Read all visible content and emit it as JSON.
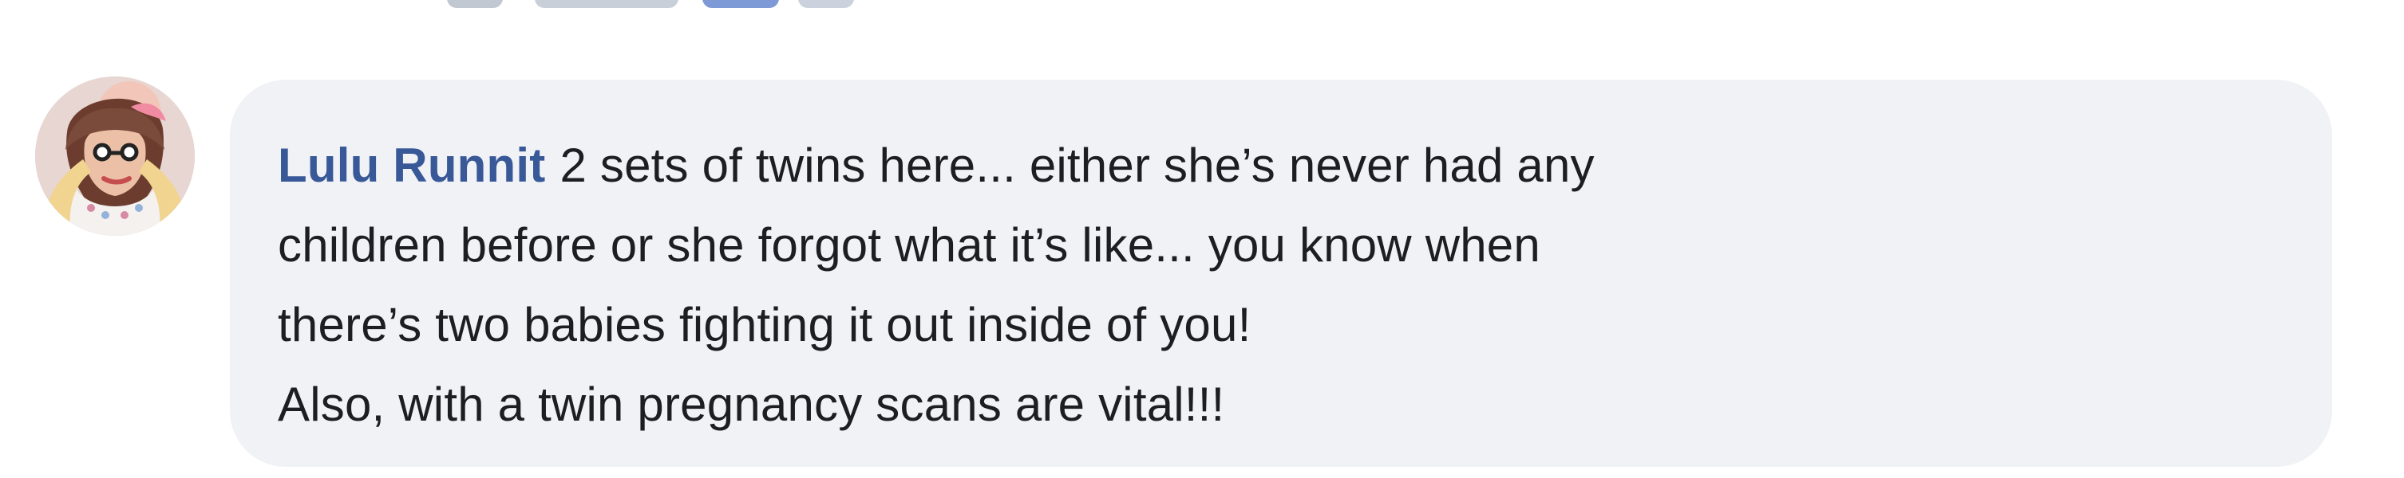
{
  "comment": {
    "author_name": "Lulu Runnit",
    "author_link_color": "#385898",
    "avatar_icon": "profile-photo",
    "lines": [
      "2 sets of twins here... either she’s never had any",
      "children before or she forgot what it’s like... you know when",
      "there’s two babies fighting it out inside of you!",
      "Also, with a twin pregnancy scans are vital!!!"
    ],
    "bubble_color": "#f0f2f5",
    "text_color": "#1c1e21"
  }
}
